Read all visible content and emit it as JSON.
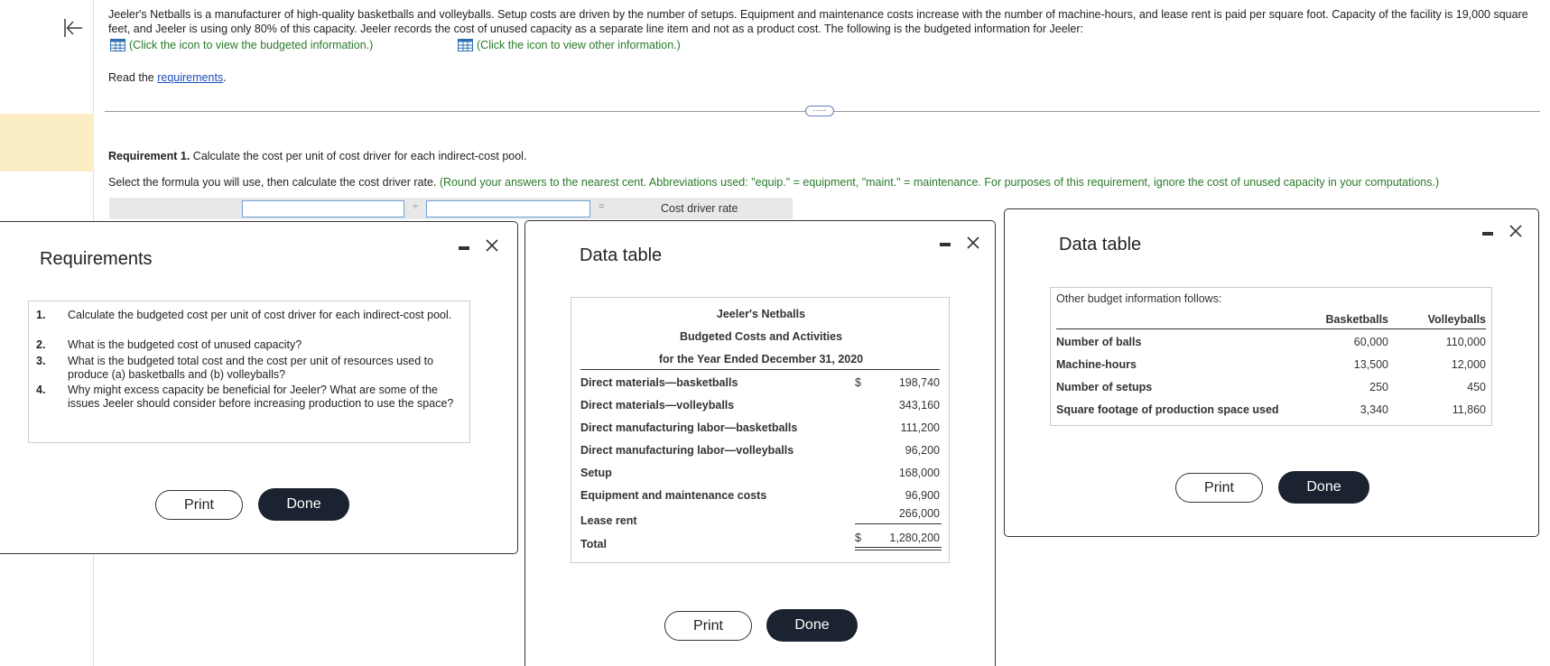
{
  "intro": {
    "text": "Jeeler's Netballs is a manufacturer of high-quality basketballs and volleyballs. Setup costs are driven by the number of setups. Equipment and maintenance costs increase with the number of machine-hours, and lease rent is paid per square foot. Capacity of the facility is 19,000 square feet, and Jeeler is using only 80% of this capacity. Jeeler records the cost of unused capacity as a separate line item and not as a product cost. The following is the budgeted information for Jeeler:",
    "link_budgeted": "(Click the icon to view the budgeted information.)",
    "link_other": "(Click the icon to view other information.)",
    "read_prefix": "Read the",
    "read_link": "requirements",
    "read_suffix": "."
  },
  "requirement1": {
    "label": "Requirement 1.",
    "text": "Calculate the cost per unit of cost driver for each indirect-cost pool.",
    "select_text": "Select the formula you will use, then calculate the cost driver rate.",
    "hint": "(Round your answers to the nearest cent. Abbreviations used: \"equip.\" = equipment, \"maint.\" = maintenance. For purposes of this requirement, ignore the cost of unused capacity in your computations.)",
    "op_divide": "÷",
    "op_equals": "=",
    "result_label": "Cost driver rate"
  },
  "ellipsis": "·····",
  "dialog_requirements": {
    "title": "Requirements",
    "items": [
      {
        "num": "1.",
        "text": "Calculate the budgeted cost per unit of cost driver for each indirect-cost pool."
      },
      {
        "num": "2.",
        "text": "What is the budgeted cost of unused capacity?"
      },
      {
        "num": "3.",
        "text": "What is the budgeted total cost and the cost per unit of resources used to produce (a) basketballs and (b) volleyballs?"
      },
      {
        "num": "4.",
        "text": "Why might excess capacity be beneficial for Jeeler? What are some of the issues Jeeler should consider before increasing production to use the space?"
      }
    ],
    "print": "Print",
    "done": "Done"
  },
  "dialog_costs": {
    "title": "Data table",
    "company": "Jeeler's Netballs",
    "subtitle": "Budgeted Costs and Activities",
    "period": "for the Year Ended December 31, 2020",
    "rows": [
      {
        "label": "Direct materials—basketballs",
        "dollar": "$",
        "value": "198,740"
      },
      {
        "label": "Direct materials—volleyballs",
        "dollar": "",
        "value": "343,160"
      },
      {
        "label": "Direct manufacturing labor—basketballs",
        "dollar": "",
        "value": "111,200"
      },
      {
        "label": "Direct manufacturing labor—volleyballs",
        "dollar": "",
        "value": "96,200"
      },
      {
        "label": "Setup",
        "dollar": "",
        "value": "168,000"
      },
      {
        "label": "Equipment and maintenance costs",
        "dollar": "",
        "value": "96,900"
      },
      {
        "label": "Lease rent",
        "dollar": "",
        "value": "266,000"
      }
    ],
    "total_label": "Total",
    "total_dollar": "$",
    "total_value": "1,280,200",
    "print": "Print",
    "done": "Done"
  },
  "dialog_other": {
    "title": "Data table",
    "caption": "Other budget information follows:",
    "col_basketballs": "Basketballs",
    "col_volleyballs": "Volleyballs",
    "rows": [
      {
        "label": "Number of balls",
        "basketballs": "60,000",
        "volleyballs": "110,000"
      },
      {
        "label": "Machine-hours",
        "basketballs": "13,500",
        "volleyballs": "12,000"
      },
      {
        "label": "Number of setups",
        "basketballs": "250",
        "volleyballs": "450"
      },
      {
        "label": "Square footage of production space used",
        "basketballs": "3,340",
        "volleyballs": "11,860"
      }
    ],
    "print": "Print",
    "done": "Done"
  },
  "colors": {
    "green_hint": "#2a7a2a",
    "link_blue": "#1a4fb5",
    "done_bg": "#1b2330",
    "rail_highlight": "#fbeec5"
  }
}
